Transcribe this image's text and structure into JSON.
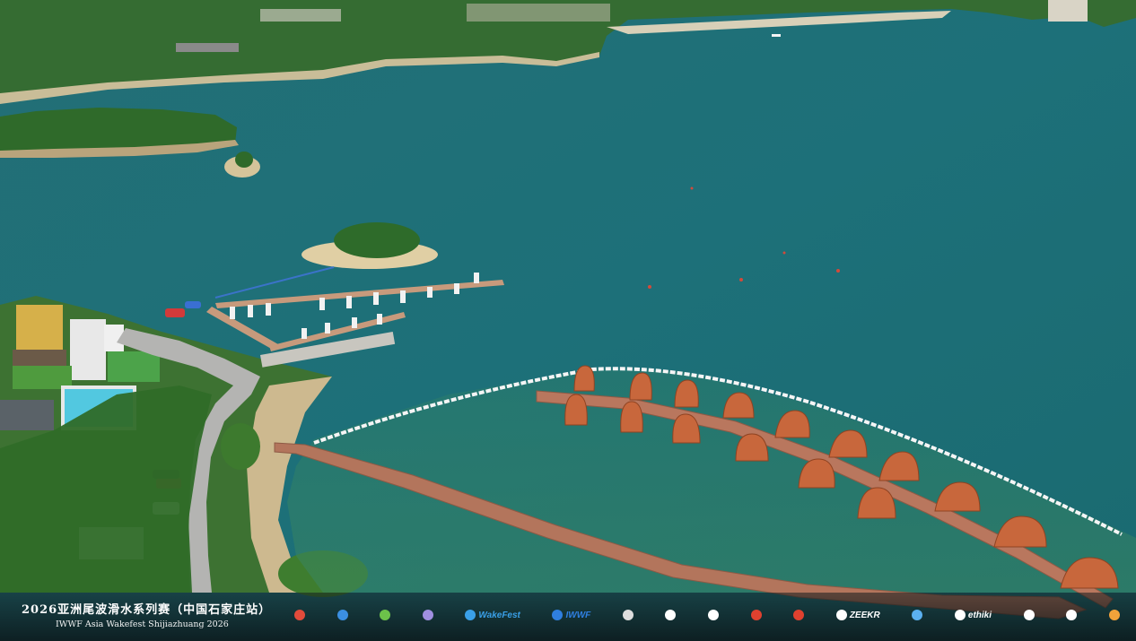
{
  "scene": {
    "description_visible": false,
    "colors": {
      "water": "#1f7379",
      "shallow_water": "#2f7f6a",
      "vegetation": "#2f6a2a",
      "sand": "#d9c9a0",
      "deck": "#b9775e",
      "cabin_roof": "#c8673c",
      "boom": "#f2f2f2"
    }
  },
  "banner": {
    "title_cn": "2026亚洲尾波滑水系列赛（中国石家庄站）",
    "title_en": "IWWF Asia Wakefest Shijiazhuang 2026",
    "sponsors": [
      {
        "label": "",
        "icon": "circle-logo-icon",
        "color": "#e24b3b"
      },
      {
        "label": "",
        "icon": "circle-logo-icon",
        "color": "#3b8fe2"
      },
      {
        "label": "",
        "icon": "circle-logo-icon",
        "color": "#6cc24a"
      },
      {
        "label": "",
        "icon": "swirl-logo-icon",
        "color": "#a08fe0"
      },
      {
        "label": "WakeFest",
        "icon": "wakefest-logo-icon",
        "color": "#3aa0e8"
      },
      {
        "label": "IWWF",
        "icon": "iwwf-logo-icon",
        "color": "#2f7fe0"
      },
      {
        "label": "",
        "icon": "bar-logo-icon",
        "color": "#dddddd"
      },
      {
        "label": "",
        "icon": "w-logo-icon",
        "color": "#ffffff"
      },
      {
        "label": "",
        "icon": "script-logo-icon",
        "color": "#ffffff"
      },
      {
        "label": "",
        "icon": "red-logo-icon",
        "color": "#e0412f"
      },
      {
        "label": "",
        "icon": "box-logo-icon",
        "color": "#e0412f"
      },
      {
        "label": "ZEEKR",
        "icon": "zeekr-logo-icon",
        "color": "#ffffff"
      },
      {
        "label": "",
        "icon": "sail-logo-icon",
        "color": "#5bb0f0"
      },
      {
        "label": "ethiki",
        "icon": "ethiki-logo-icon",
        "color": "#ffffff"
      },
      {
        "label": "",
        "icon": "text-logo-icon",
        "color": "#ffffff"
      },
      {
        "label": "",
        "icon": "4d-logo-icon",
        "color": "#ffffff"
      },
      {
        "label": "",
        "icon": "multi-logo-icon",
        "color": "#f2a23a"
      }
    ]
  }
}
